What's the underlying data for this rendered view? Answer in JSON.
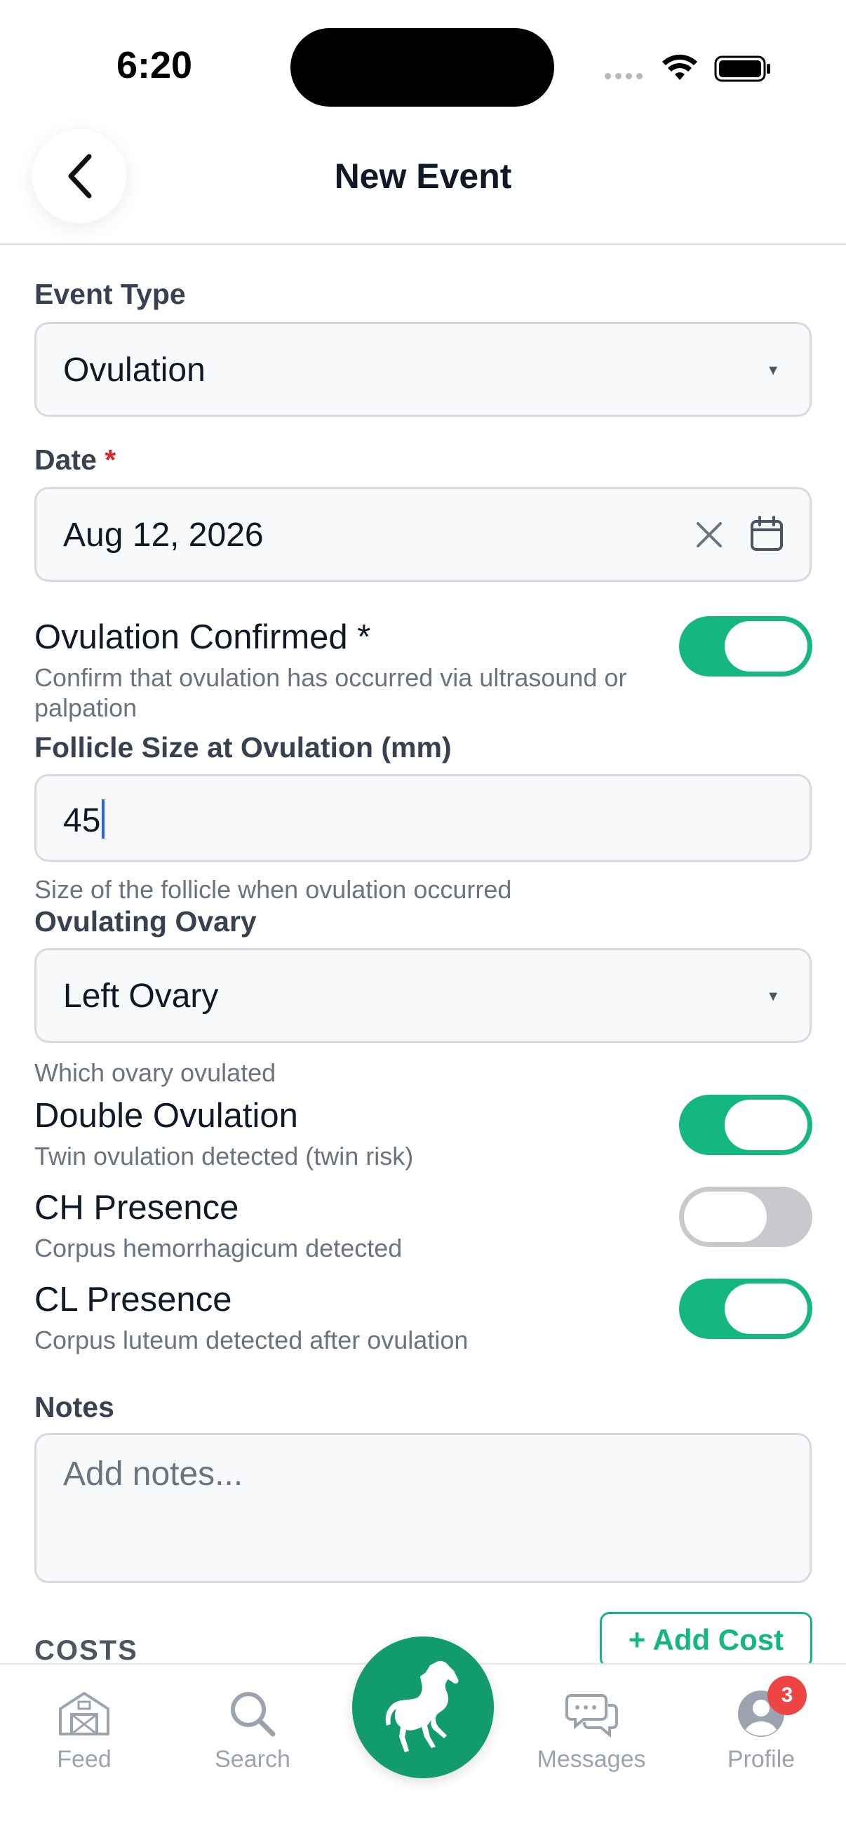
{
  "status_bar": {
    "time": "6:20"
  },
  "header": {
    "title": "New Event"
  },
  "form": {
    "event_type": {
      "label": "Event Type",
      "value": "Ovulation"
    },
    "date": {
      "label": "Date",
      "required_mark": "*",
      "value": "Aug 12, 2026"
    },
    "ovulation_confirmed": {
      "title": "Ovulation Confirmed *",
      "description": "Confirm that ovulation has occurred via ultrasound or palpation",
      "on": true
    },
    "follicle_size": {
      "label": "Follicle Size at Ovulation (mm)",
      "value": "45",
      "helper": "Size of the follicle when ovulation occurred"
    },
    "ovulating_ovary": {
      "label": "Ovulating Ovary",
      "value": "Left Ovary",
      "helper": "Which ovary ovulated"
    },
    "double_ovulation": {
      "title": "Double Ovulation",
      "description": "Twin ovulation detected (twin risk)",
      "on": true
    },
    "ch_presence": {
      "title": "CH Presence",
      "description": "Corpus hemorrhagicum detected",
      "on": false
    },
    "cl_presence": {
      "title": "CL Presence",
      "description": "Corpus luteum detected after ovulation",
      "on": true
    },
    "notes": {
      "label": "Notes",
      "placeholder": "Add notes..."
    },
    "costs": {
      "label": "COSTS",
      "add_button": "+ Add Cost"
    }
  },
  "bottom_nav": {
    "items": [
      {
        "label": "Feed",
        "icon": "barn-icon"
      },
      {
        "label": "Search",
        "icon": "search-icon"
      },
      {
        "label": "",
        "icon": "horse-icon"
      },
      {
        "label": "Messages",
        "icon": "chat-bubbles-icon"
      },
      {
        "label": "Profile",
        "icon": "user-avatar-icon",
        "badge": "3"
      }
    ]
  },
  "colors": {
    "accent": "#14b87e",
    "fab": "#129b6b",
    "badge": "#ef4444",
    "required": "#dc2626"
  }
}
